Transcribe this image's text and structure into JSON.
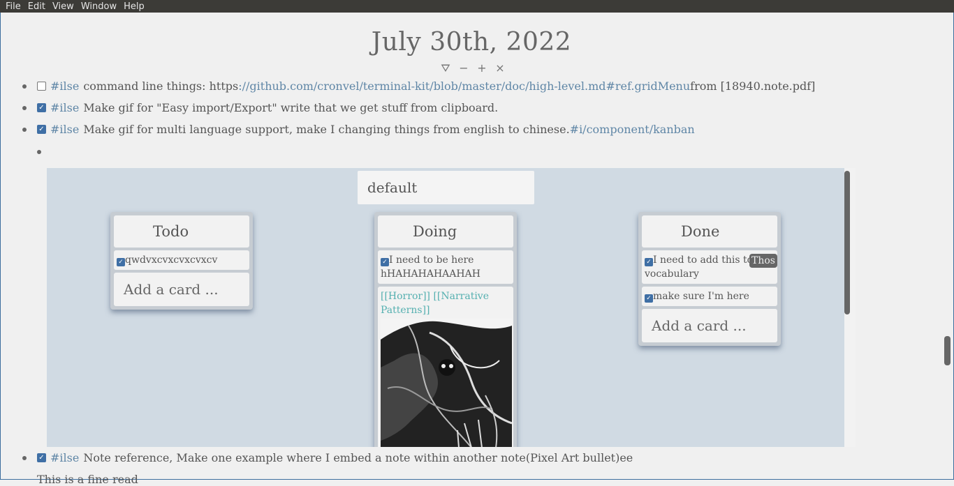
{
  "menu": [
    "File",
    "Edit",
    "View",
    "Window",
    "Help"
  ],
  "page": {
    "title": "July 30th, 2022"
  },
  "title_tools": [
    "filter-icon",
    "collapse-icon",
    "expand-icon",
    "close-icon"
  ],
  "bullets": [
    {
      "checked": false,
      "tag": "#ilse",
      "text": "command line things: https ",
      "link": "://github.com/cronvel/terminal-kit/blob/master/doc/high-level.md#ref.gridMenu",
      "suffix": " from [18940.note.pdf]"
    },
    {
      "checked": true,
      "tag": "#ilse",
      "text": "Make gif for \"Easy import/Export\" write that we get stuff from clipboard."
    },
    {
      "checked": true,
      "tag": "#ilse",
      "text": "Make gif for multi language support, make I changing things from english to chinese. ",
      "link": "#i/component/kanban"
    },
    {
      "checked": true,
      "tag": "#ilse",
      "text": "Note reference, Make one example where I embed a note within another note(Pixel Art bullet)ee"
    }
  ],
  "kanban": {
    "board_title": "default",
    "columns": [
      {
        "title": "Todo",
        "cards": [
          "qwdvxcvxcvxcvxcv"
        ],
        "add_label": "Add a card ..."
      },
      {
        "title": "Doing",
        "cards": [
          "I need to be here hHAHAHAHAAHAH"
        ],
        "ref_text": "[[Horror]] [[Narrative Patterns]]"
      },
      {
        "title": "Done",
        "cards": [
          "I need to add this to the vocabulary",
          "make sure I'm here"
        ],
        "tooltip": "Thos",
        "add_label": "Add a card ..."
      }
    ]
  },
  "partial_line": "This is a fine read"
}
